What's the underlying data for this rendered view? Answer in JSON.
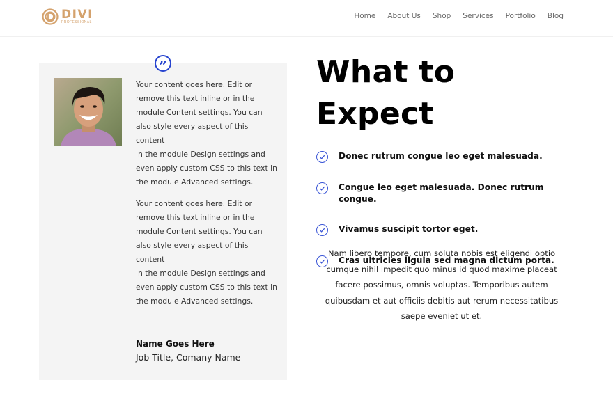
{
  "header": {
    "logo": {
      "word": "DIVI",
      "sub": "PROFESSIONAL",
      "color": "#d4a26d"
    },
    "nav": [
      "Home",
      "About Us",
      "Shop",
      "Services",
      "Portfolio",
      "Blog"
    ]
  },
  "testimonial": {
    "quote_icon": "quote-icon",
    "accent": "#2845cf",
    "portrait_alt": "Smiling man portrait",
    "paragraphs": [
      "Your content goes here. Edit or\nremove this text inline or in the\nmodule Content settings. You can\nalso style every aspect of this content\nin the module Design settings and\neven apply custom CSS to this text in\nthe module Advanced settings.",
      "Your content goes here. Edit or\nremove this text inline or in the\nmodule Content settings. You can\nalso style every aspect of this content\nin the module Design settings and\neven apply custom CSS to this text in\nthe module Advanced settings."
    ],
    "author_name": "Name Goes Here",
    "author_job": "Job Title, Comany Name"
  },
  "main": {
    "headline": "What to Expect",
    "check_color": "#3a55d6",
    "checklist": [
      "Donec rutrum congue leo eget malesuada.",
      "Congue leo eget malesuada. Donec rutrum congue.",
      "Vivamus suscipit tortor eget.",
      "Cras ultricies ligula sed magna dictum porta."
    ],
    "description": "Nam libero tempore, cum soluta nobis est eligendi optio cumque nihil impedit quo minus id quod maxime placeat facere possimus, omnis voluptas. Temporibus autem quibusdam et aut officiis debitis aut rerum necessitatibus saepe eveniet ut et."
  }
}
